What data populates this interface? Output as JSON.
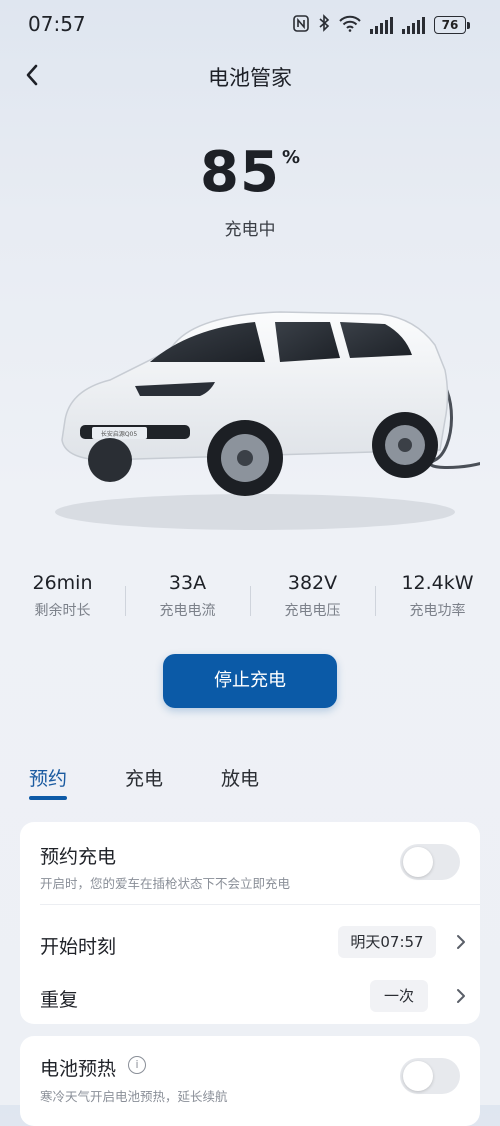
{
  "status_bar": {
    "time": "07:57",
    "battery_percent": "76",
    "icons": [
      "nfc-icon",
      "bluetooth-icon",
      "wifi-icon",
      "signal-icon",
      "signal-icon",
      "battery-icon"
    ]
  },
  "header": {
    "title": "电池管家",
    "back_icon": "chevron-left-icon"
  },
  "charge": {
    "soc_value": "85",
    "soc_unit": "%",
    "status": "充电中",
    "car_badge": "长安启源Q05"
  },
  "stats": [
    {
      "value": "26min",
      "label": "剩余时长"
    },
    {
      "value": "33A",
      "label": "充电电流"
    },
    {
      "value": "382V",
      "label": "充电电压"
    },
    {
      "value": "12.4kW",
      "label": "充电功率"
    }
  ],
  "stop_button": {
    "label": "停止充电",
    "color": "#0b5aa7"
  },
  "tabs": [
    {
      "label": "预约",
      "active": true
    },
    {
      "label": "充电",
      "active": false
    },
    {
      "label": "放电",
      "active": false
    }
  ],
  "schedule_card": {
    "title": "预约充电",
    "subtitle": "开启时，您的爱车在插枪状态下不会立即充电",
    "toggle_on": false,
    "start_time": {
      "label": "开始时刻",
      "value": "明天07:57"
    },
    "repeat": {
      "label": "重复",
      "value": "一次"
    }
  },
  "preheat_card": {
    "title": "电池预热",
    "info_icon": "i",
    "subtitle": "寒冷天气开启电池预热，延长续航",
    "toggle_on": false
  },
  "colors": {
    "accent": "#0b5aa7",
    "background": "#e8ecf3"
  }
}
